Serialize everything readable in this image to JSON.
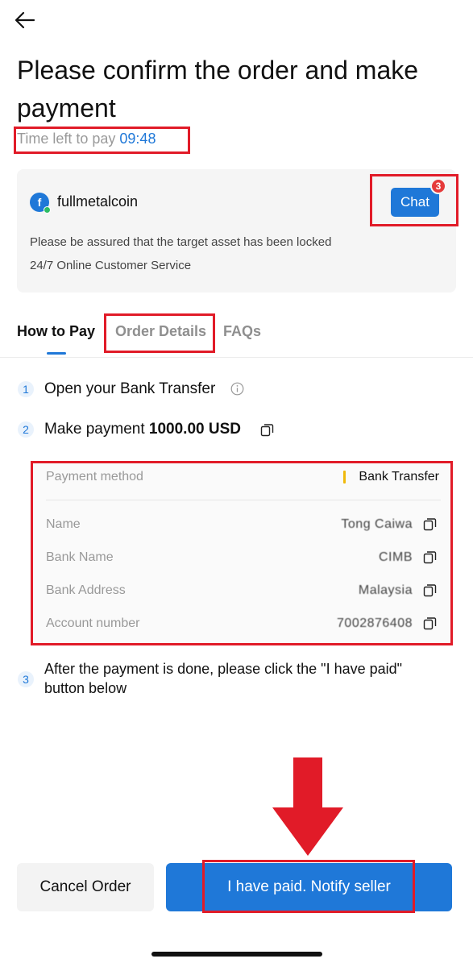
{
  "header": {
    "title": "Please confirm the order and make payment",
    "timer_label": "Time left to pay",
    "timer_value": "09:48"
  },
  "merchant": {
    "avatar_letter": "f",
    "name": "fullmetalcoin",
    "chat_label": "Chat",
    "chat_badge": "3",
    "note_locked": "Please be assured that the target asset has been locked",
    "note_service": "24/7 Online Customer Service"
  },
  "tabs": [
    {
      "label": "How to Pay",
      "active": true
    },
    {
      "label": "Order Details",
      "active": false
    },
    {
      "label": "FAQs",
      "active": false
    }
  ],
  "steps": {
    "step1": {
      "num": "1",
      "text": "Open your Bank Transfer"
    },
    "step2": {
      "num": "2",
      "text": "Make payment",
      "amount": "1000.00 USD"
    },
    "step3": {
      "num": "3",
      "text_line1": "After the payment is done, please click the \"I have paid\"",
      "text_line2": "button below"
    }
  },
  "payment": {
    "method_label": "Payment method",
    "method_value": "Bank Transfer",
    "fields": [
      {
        "label": "Name",
        "value": "Tong Caiwa"
      },
      {
        "label": "Bank Name",
        "value": "CIMB"
      },
      {
        "label": "Bank Address",
        "value": "Malaysia"
      },
      {
        "label": "Account number",
        "value": "7002876408"
      }
    ]
  },
  "actions": {
    "cancel_label": "Cancel Order",
    "paid_label": "I have paid. Notify seller"
  },
  "colors": {
    "accent": "#1f78d8",
    "highlight": "#e11b28",
    "badge": "#e53a3a",
    "method_bar": "#f0b90b"
  }
}
